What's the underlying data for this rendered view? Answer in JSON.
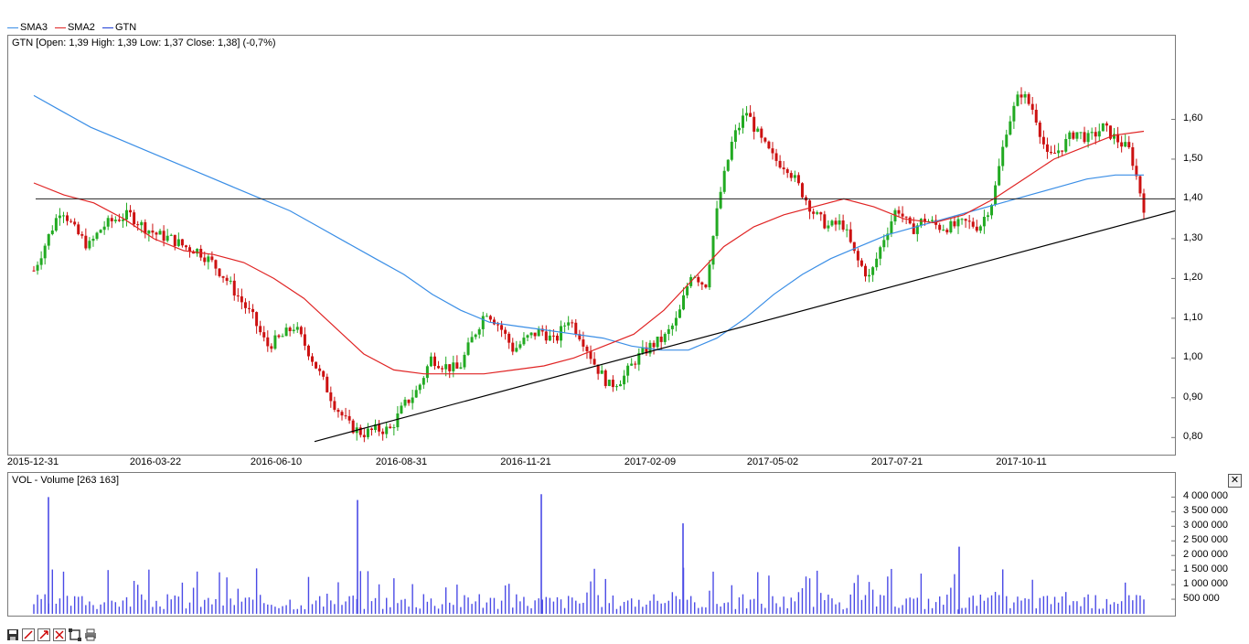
{
  "legend": [
    {
      "label": "SMA3",
      "color": "#3a8ee6"
    },
    {
      "label": "SMA2",
      "color": "#e02424"
    },
    {
      "label": "GTN",
      "color": "#1f3fd6"
    }
  ],
  "price_panel": {
    "title": "GTN [Open: 1,39  High: 1,39  Low: 1,37  Close: 1,38] (-0,7%)"
  },
  "volume_panel": {
    "title": "VOL - Volume [263 163]"
  },
  "close_icon": "close-icon",
  "toolbar": [
    {
      "name": "save-icon"
    },
    {
      "name": "draw-line-icon"
    },
    {
      "name": "draw-arrow-icon"
    },
    {
      "name": "zoom-in-icon"
    },
    {
      "name": "fit-screen-icon"
    },
    {
      "name": "print-icon"
    }
  ],
  "colors": {
    "up": "#22aa22",
    "down": "#cc1111",
    "volume": "#4a4ae6",
    "sma3": "#3a8ee6",
    "sma2": "#e02424",
    "trendline": "#000000"
  },
  "chart_data": [
    {
      "type": "candlestick",
      "series_name": "GTN",
      "ylim": [
        0.78,
        1.7
      ],
      "y_ticks": [
        "1,60",
        "1,50",
        "1,40",
        "1,30",
        "1,20",
        "1,10",
        "1,00",
        "0,90",
        "0,80"
      ],
      "x_ticks": [
        "2015-12-31",
        "2016-03-22",
        "2016-06-10",
        "2016-08-31",
        "2016-11-21",
        "2017-02-09",
        "2017-05-02",
        "2017-07-21",
        "2017-10-11"
      ],
      "close_approx": [
        1.22,
        1.3,
        1.38,
        1.32,
        1.28,
        1.33,
        1.35,
        1.36,
        1.33,
        1.31,
        1.3,
        1.28,
        1.27,
        1.24,
        1.2,
        1.15,
        1.1,
        1.03,
        1.05,
        1.08,
        1.02,
        0.95,
        0.88,
        0.83,
        0.81,
        0.82,
        0.82,
        0.88,
        0.92,
        1.0,
        0.98,
        0.97,
        1.05,
        1.12,
        1.08,
        1.02,
        1.05,
        1.07,
        1.04,
        1.1,
        1.05,
        0.98,
        0.93,
        0.95,
        1.0,
        1.03,
        1.05,
        1.1,
        1.22,
        1.18,
        1.4,
        1.55,
        1.62,
        1.55,
        1.5,
        1.48,
        1.42,
        1.36,
        1.33,
        1.34,
        1.25,
        1.2,
        1.3,
        1.38,
        1.32,
        1.35,
        1.33,
        1.33,
        1.34,
        1.33,
        1.4,
        1.58,
        1.67,
        1.62,
        1.5,
        1.53,
        1.57,
        1.55,
        1.58,
        1.55,
        1.52,
        1.38
      ],
      "sma3_approx": [
        1.66,
        1.62,
        1.58,
        1.55,
        1.52,
        1.49,
        1.46,
        1.43,
        1.4,
        1.37,
        1.33,
        1.29,
        1.25,
        1.21,
        1.16,
        1.12,
        1.09,
        1.08,
        1.07,
        1.06,
        1.05,
        1.03,
        1.02,
        1.02,
        1.05,
        1.1,
        1.16,
        1.21,
        1.25,
        1.28,
        1.31,
        1.33,
        1.35,
        1.37,
        1.39,
        1.41,
        1.43,
        1.45,
        1.46,
        1.46
      ],
      "sma2_approx": [
        1.44,
        1.41,
        1.39,
        1.35,
        1.3,
        1.27,
        1.26,
        1.24,
        1.2,
        1.15,
        1.08,
        1.01,
        0.97,
        0.96,
        0.96,
        0.96,
        0.97,
        0.98,
        1.0,
        1.03,
        1.06,
        1.12,
        1.2,
        1.28,
        1.33,
        1.36,
        1.38,
        1.4,
        1.38,
        1.35,
        1.34,
        1.36,
        1.4,
        1.45,
        1.5,
        1.53,
        1.56,
        1.57
      ],
      "horizontal_line": 1.4,
      "trendline": [
        [
          "2016-07-01",
          0.79
        ],
        [
          "2017-12-29",
          1.37
        ]
      ]
    },
    {
      "type": "bar",
      "series_name": "Volume",
      "ylim": [
        0,
        4200000
      ],
      "y_ticks": [
        "4 000 000",
        "3 500 000",
        "3 000 000",
        "2 500 000",
        "2 000 000",
        "1 500 000",
        "1 000 000",
        "500 000"
      ],
      "spikes": [
        {
          "x": "2016-01-06",
          "value": 4000000
        },
        {
          "x": "2016-07-15",
          "value": 3900000
        },
        {
          "x": "2016-12-01",
          "value": 4100000
        },
        {
          "x": "2017-02-20",
          "value": 3100000
        },
        {
          "x": "2017-09-05",
          "value": 2300000
        }
      ]
    }
  ]
}
